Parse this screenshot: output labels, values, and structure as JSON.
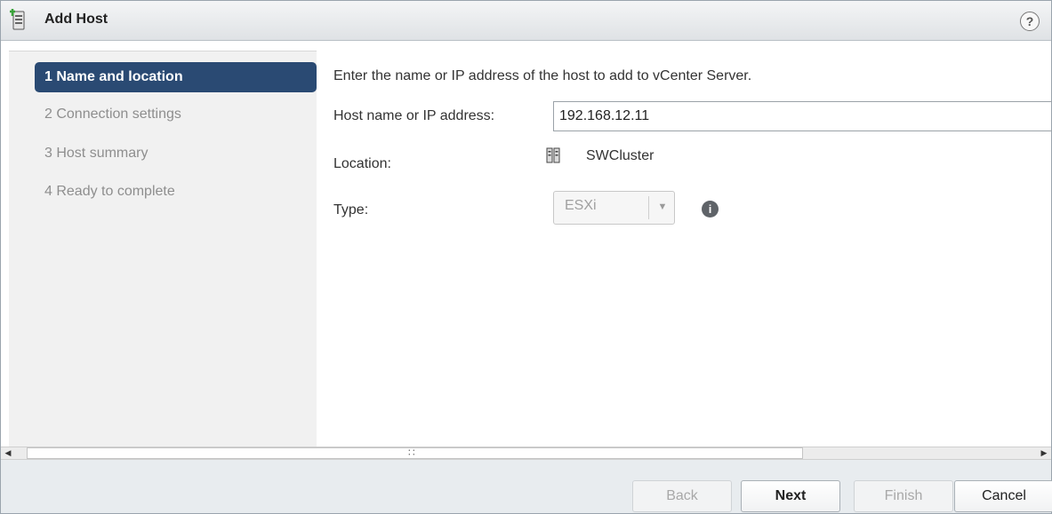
{
  "window": {
    "title": "Add Host",
    "help_label": "?"
  },
  "steps": [
    {
      "label": "1 Name and location",
      "active": true
    },
    {
      "label": "2 Connection settings",
      "active": false
    },
    {
      "label": "3 Host summary",
      "active": false
    },
    {
      "label": "4 Ready to complete",
      "active": false
    }
  ],
  "form": {
    "instruction": "Enter the name or IP address of the host to add to vCenter Server.",
    "host_label": "Host name or IP address:",
    "host_value": "192.168.12.11",
    "location_label": "Location:",
    "location_value": "SWCluster",
    "location_icon": "cluster-icon",
    "type_label": "Type:",
    "type_value": "ESXi",
    "info_icon": "info-icon"
  },
  "buttons": {
    "back": "Back",
    "next": "Next",
    "finish": "Finish",
    "cancel": "Cancel"
  },
  "colors": {
    "active_step_bg": "#2a4a73",
    "footer_bg": "#e8ecef",
    "steps_bg": "#f1f1f1"
  }
}
